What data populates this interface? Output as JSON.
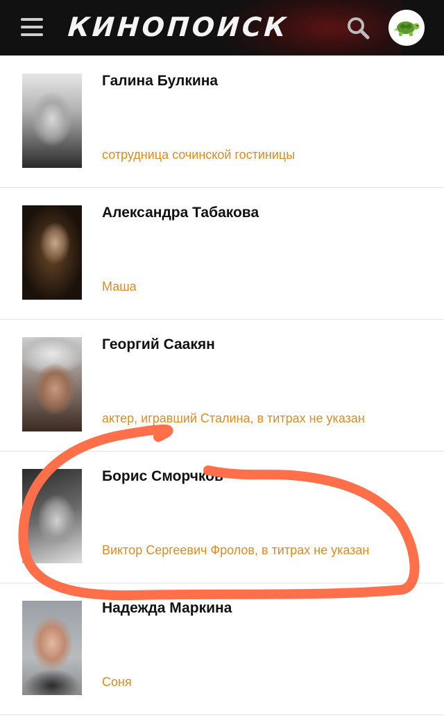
{
  "header": {
    "logo_text": "КИНОПОИСК",
    "menu_icon": "hamburger-menu-icon",
    "search_icon": "search-icon",
    "avatar_icon": "turtle-avatar-icon"
  },
  "colors": {
    "header_bg": "#111111",
    "role_text": "#e08a1e",
    "annotation_stroke": "#ff6f4a"
  },
  "cast": [
    {
      "name": "Галина Булкина",
      "role": "сотрудница сочинской гостиницы"
    },
    {
      "name": "Александра Табакова",
      "role": "Маша"
    },
    {
      "name": "Георгий Саакян",
      "role": "актер, игравший Сталина, в титрах не указан"
    },
    {
      "name": "Борис Сморчков",
      "role": "Виктор Сергеевич Фролов, в титрах не указан"
    },
    {
      "name": "Надежда Маркина",
      "role": "Соня"
    }
  ]
}
